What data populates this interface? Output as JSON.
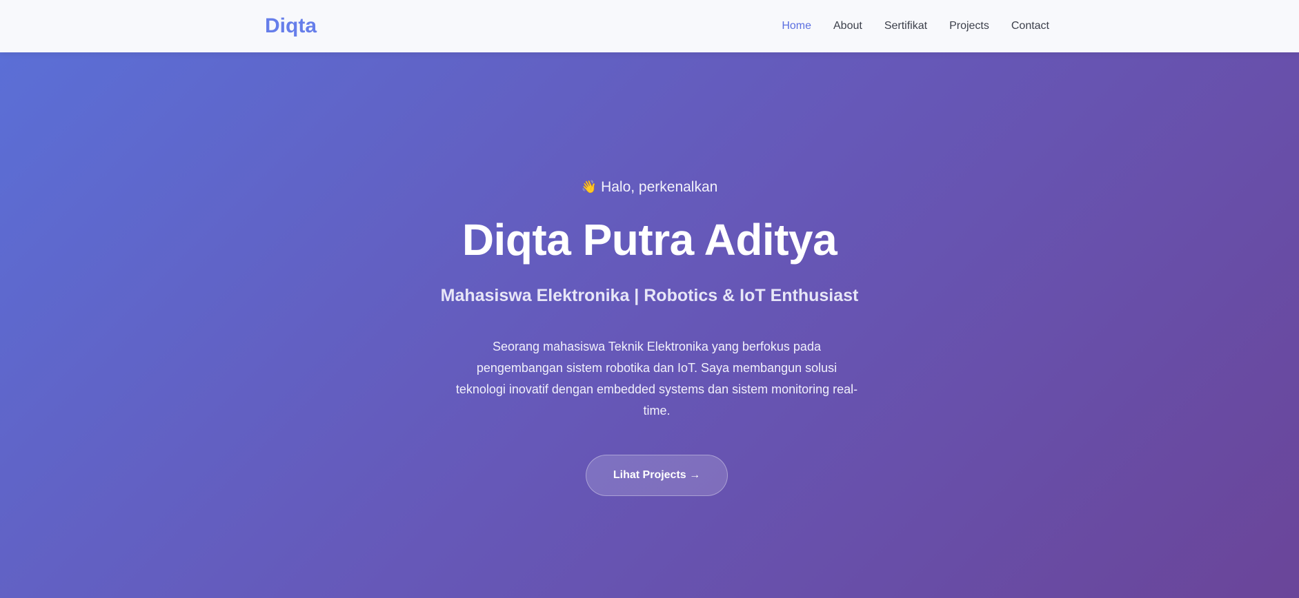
{
  "nav": {
    "brand": "Diqta",
    "links": [
      {
        "label": "Home",
        "active": true
      },
      {
        "label": "About",
        "active": false
      },
      {
        "label": "Sertifikat",
        "active": false
      },
      {
        "label": "Projects",
        "active": false
      },
      {
        "label": "Contact",
        "active": false
      }
    ]
  },
  "hero": {
    "greeting_icon": "👋",
    "greeting": "Halo, perkenalkan",
    "name": "Diqta Putra Aditya",
    "role": "Mahasiswa Elektronika | Robotics & IoT Enthusiast",
    "description": "Seorang mahasiswa Teknik Elektronika yang berfokus pada pengembangan sistem robotika dan IoT. Saya membangun solusi teknologi inovatif dengan embedded systems dan sistem monitoring real-time.",
    "cta_label": "Lihat Projects →"
  },
  "colors": {
    "brand": "#667eea",
    "nav_active": "#5b6fe0",
    "gradient_start": "#5b6fd6",
    "gradient_end": "#6a4599"
  }
}
